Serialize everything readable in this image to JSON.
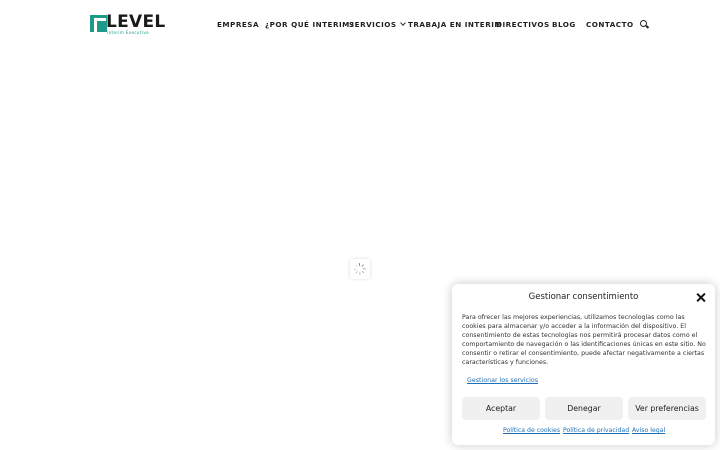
{
  "brand": {
    "logo_text": "LEVEL",
    "logo_tagline": "Interim Executive"
  },
  "nav": {
    "items": [
      {
        "label": "EMPRESA"
      },
      {
        "label": "¿POR QUÉ INTERIM?"
      },
      {
        "label": "SERVICIOS",
        "has_dropdown": true
      },
      {
        "label": "TRABAJA EN INTERIM"
      },
      {
        "label": "DIRECTIVOS"
      },
      {
        "label": "BLOG"
      },
      {
        "label": "CONTACTO"
      }
    ],
    "search_icon": "search-icon"
  },
  "main": {
    "loading_icon": "spinner-icon"
  },
  "consent": {
    "title": "Gestionar consentimiento",
    "close_icon": "close-icon",
    "body": "Para ofrecer las mejores experiencias, utilizamos tecnologías como las cookies para almacenar y/o acceder a la información del dispositivo. El consentimiento de estas tecnologías nos permitirá procesar datos como el comportamiento de navegación o las identificaciones únicas en este sitio. No consentir o retirar el consentimiento, puede afectar negativamente a ciertas características y funciones.",
    "manage_services": "Gestionar los servicios",
    "accept_label": "Aceptar",
    "deny_label": "Denegar",
    "preferences_label": "Ver preferencias",
    "links": {
      "cookies_policy": "Política de cookies",
      "privacy_policy": "Política de privacidad",
      "legal_notice": "Aviso legal"
    }
  },
  "colors": {
    "brand_teal": "#1d9a8a",
    "link_blue": "#1e6fb5",
    "button_bg": "#f0f0f0"
  }
}
